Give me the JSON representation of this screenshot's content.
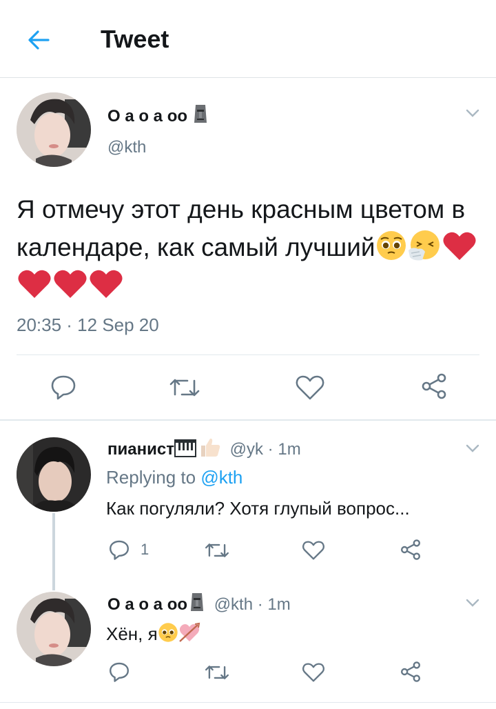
{
  "header": {
    "title": "Tweet"
  },
  "main_tweet": {
    "display_name": "О а о а оо",
    "name_emoji": "moai-emoji",
    "handle": "@kth",
    "text": "Я отмечу этот день красным цветом в календаре, как самый лучший",
    "text_emojis": [
      "pleading-face",
      "sneezing-face",
      "red-heart",
      "red-heart",
      "red-heart",
      "red-heart"
    ],
    "timestamp": "20:35 · 12 Sep 20",
    "actions": [
      "reply-icon",
      "retweet-icon",
      "like-icon",
      "share-icon"
    ]
  },
  "replies": [
    {
      "display_name": "пианист",
      "name_emojis": [
        "piano-emoji",
        "thumbs-up-emoji"
      ],
      "handle": "@yk",
      "time": "1m",
      "replying_prefix": "Replying to",
      "replying_to": "@kth",
      "text": "Как погуляли? Хотя глупый вопрос...",
      "reply_count": "1"
    },
    {
      "display_name": "О а о а оо",
      "name_emoji": "moai-emoji",
      "handle": "@kth",
      "time": "1m",
      "text": "Хён, я",
      "text_emojis": [
        "pleading-face",
        "heart-with-arrow"
      ]
    }
  ],
  "colors": {
    "accent": "#1da1f2",
    "muted": "#657786",
    "divider": "#e1e8ed",
    "heart": "#e0245e"
  }
}
